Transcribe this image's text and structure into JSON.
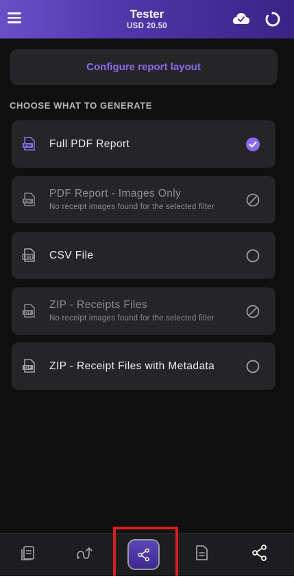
{
  "header": {
    "title": "Tester",
    "subtitle": "USD 20.50",
    "icons": [
      "hamburger-menu-icon",
      "cloud-check-icon",
      "sync-status-icon"
    ]
  },
  "configure_button": "Configure report layout",
  "section_title": "CHOOSE WHAT TO GENERATE",
  "options": [
    {
      "label": "Full PDF Report",
      "sublabel": "",
      "icon": "pdf-file-icon",
      "state": "selected"
    },
    {
      "label": "PDF Report - Images Only",
      "sublabel": "No receipt images found for the selected filter",
      "icon": "pdf-file-icon",
      "state": "disabled"
    },
    {
      "label": "CSV File",
      "sublabel": "",
      "icon": "csv-file-icon",
      "state": "unselected"
    },
    {
      "label": "ZIP - Receipts Files",
      "sublabel": "No receipt images found for the selected filter",
      "icon": "zip-file-icon",
      "state": "disabled"
    },
    {
      "label": "ZIP - Receipt Files with Metadata",
      "sublabel": "",
      "icon": "zip-file-icon",
      "state": "unselected"
    }
  ],
  "bottom_nav": [
    "receipts-icon",
    "workflow-icon",
    "share-icon",
    "document-icon",
    "share-icon"
  ],
  "colors": {
    "accent": "#8a6cf0",
    "header_start": "#6a4fc7",
    "header_end": "#3a2385",
    "highlight": "#d91e1e"
  }
}
